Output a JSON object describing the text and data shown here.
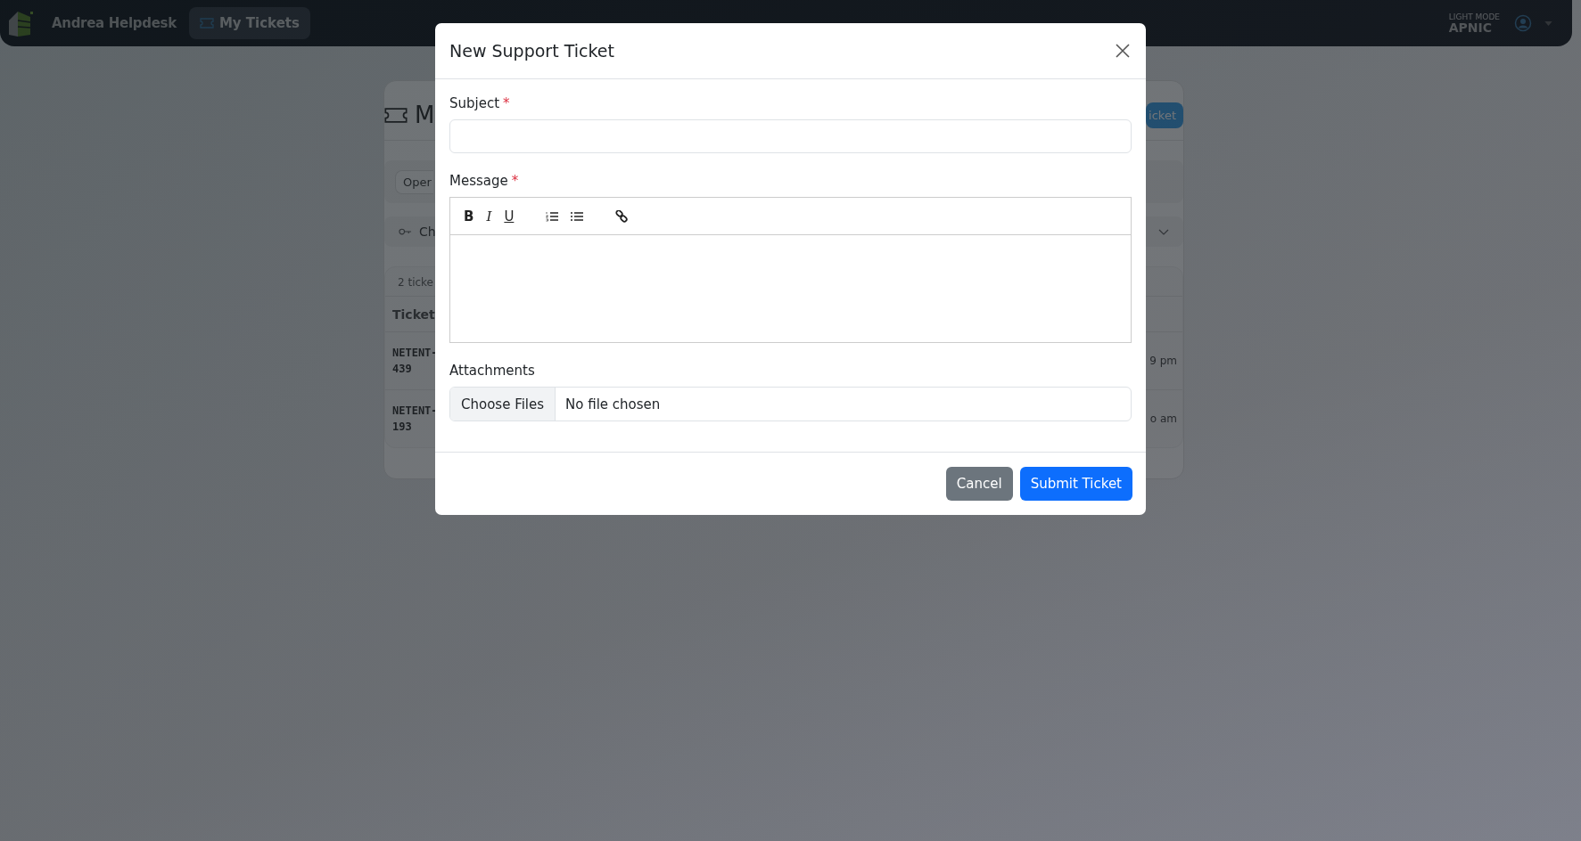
{
  "navbar": {
    "brand": "Andrea Helpdesk",
    "nav_items": [
      {
        "label": "My Tickets",
        "selected": true
      }
    ],
    "mode_label": "LIGHT MODE",
    "user": "APNIC"
  },
  "page": {
    "title": "M",
    "new_button": "icket",
    "filter": {
      "status": "Oper"
    },
    "collapse": {
      "label": "Ch"
    },
    "table": {
      "count": "2 ticke",
      "columns": [
        "Ticket"
      ],
      "rows": [
        {
          "ticket": [
            "NETENT-",
            "439"
          ],
          "time": "9 pm"
        },
        {
          "ticket": [
            "NETENT-",
            "193"
          ],
          "time": "o am"
        }
      ]
    }
  },
  "modal": {
    "title": "New Support Ticket",
    "fields": [
      {
        "kind": "text",
        "label": "Subject",
        "required_mark": "*"
      },
      {
        "kind": "editor",
        "label": "Message",
        "required_mark": "*",
        "toolbar": [
          {
            "kind": "bold",
            "text": "B"
          },
          {
            "kind": "italic",
            "text": "I"
          },
          {
            "kind": "underline",
            "text": "U"
          },
          {
            "kind": "ordered-list"
          },
          {
            "kind": "bullet-list"
          },
          {
            "kind": "link"
          }
        ]
      },
      {
        "kind": "file",
        "label": "Attachments",
        "button": "Choose Files",
        "status": "No file chosen"
      }
    ],
    "buttons": [
      {
        "kind": "secondary",
        "label": "Cancel"
      },
      {
        "kind": "primary",
        "label": "Submit Ticket"
      }
    ]
  }
}
